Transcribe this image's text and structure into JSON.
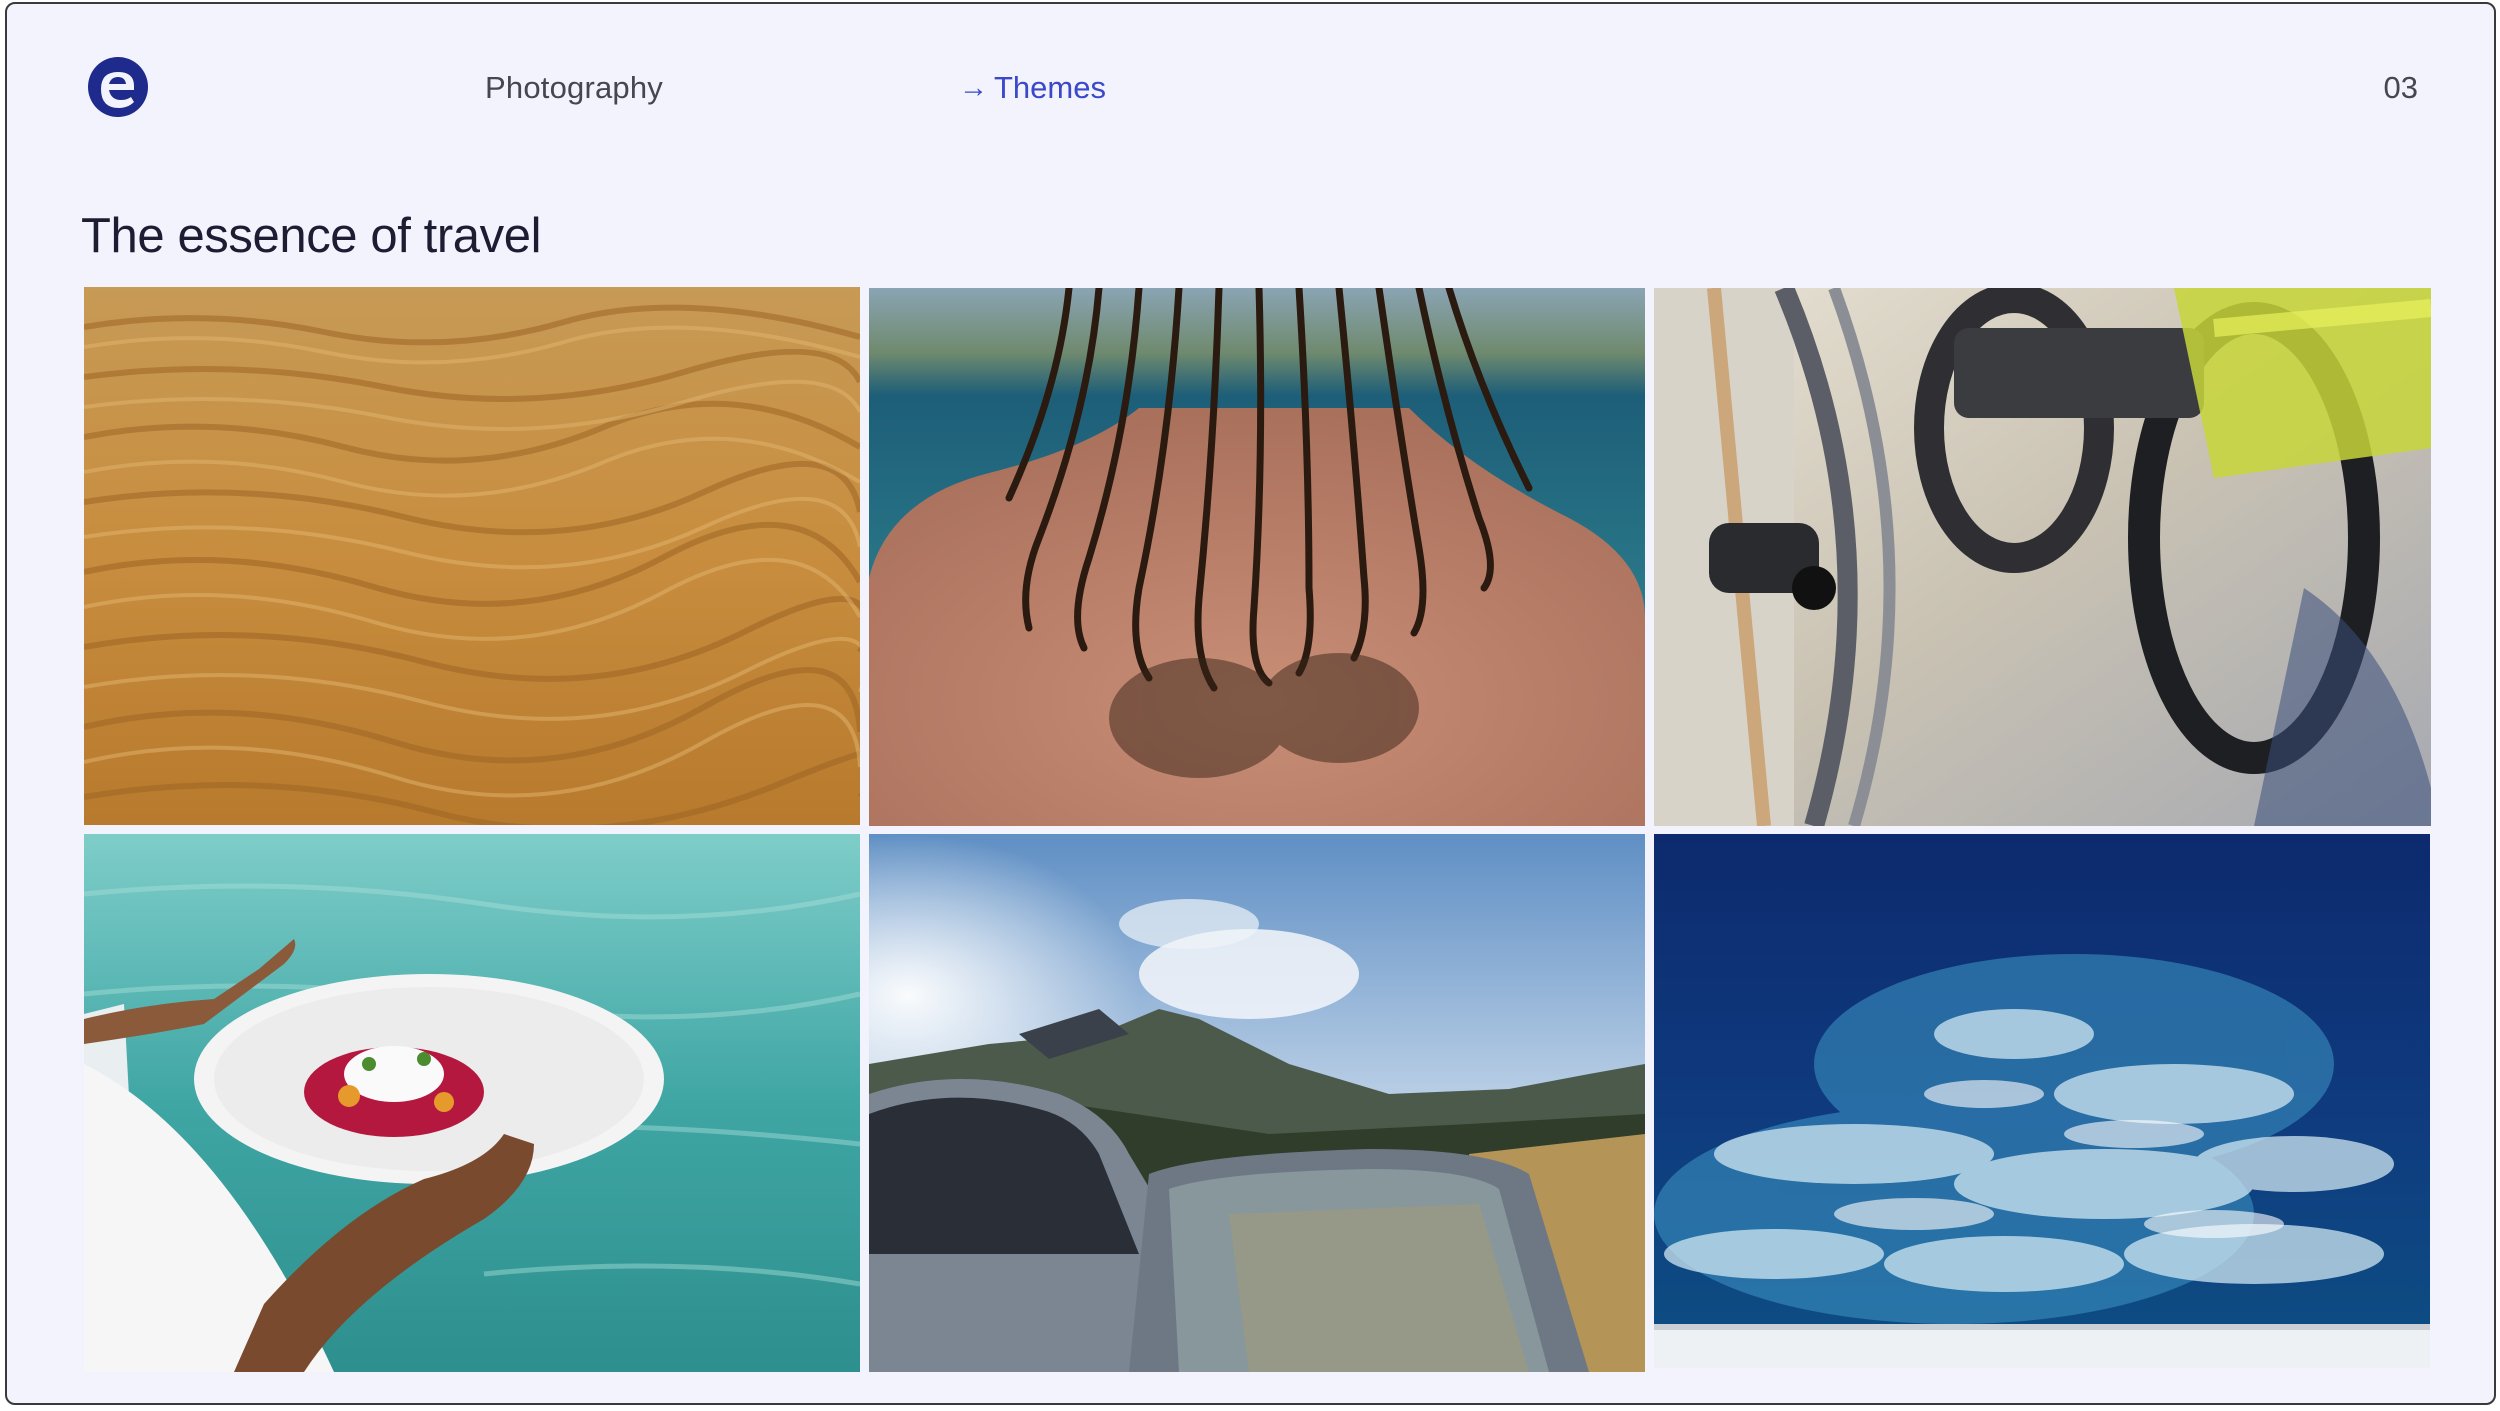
{
  "header": {
    "logo_icon": "expedia-e-logo-icon",
    "section_label": "Photography",
    "theme_arrow": "→",
    "theme_label": "Themes",
    "page_number": "03"
  },
  "main": {
    "title": "The essence of travel"
  },
  "colors": {
    "background": "#f2f3fc",
    "brand_navy": "#1e2a8c",
    "accent_blue": "#3a48c9",
    "text_dark": "#1c1d33",
    "text_muted": "#45464f"
  }
}
